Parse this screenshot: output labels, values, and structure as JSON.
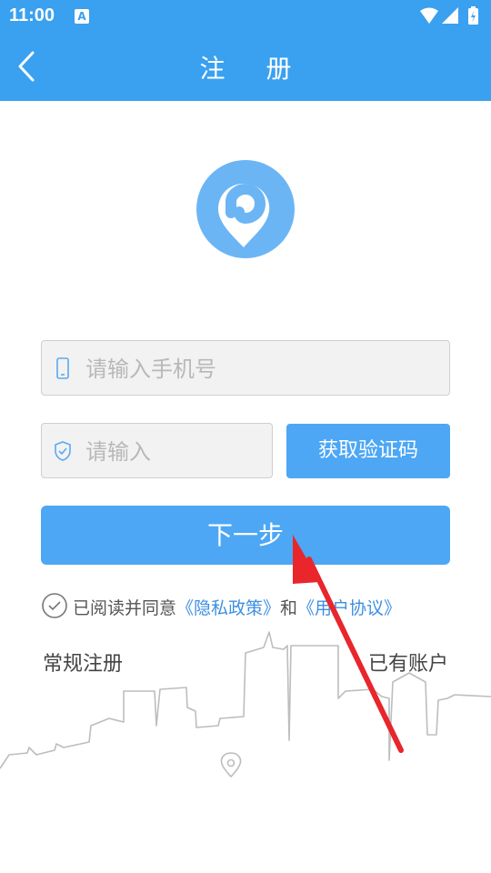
{
  "status_bar": {
    "time": "11:00",
    "notification_icon": "a-notification-icon",
    "icons": [
      "wifi-icon",
      "signal-icon",
      "battery-icon"
    ]
  },
  "header": {
    "title": "注 册",
    "back_icon": "back-arrow-icon"
  },
  "logo_icon": "location-pin-logo",
  "form": {
    "phone": {
      "placeholder": "请输入手机号",
      "value": "",
      "icon": "phone-icon"
    },
    "code": {
      "placeholder": "请输入",
      "value": "",
      "icon": "shield-icon"
    },
    "get_code_label": "获取验证码",
    "next_label": "下一步"
  },
  "agreement": {
    "prefix": "已阅读并同意",
    "privacy_link": "《隐私政策》",
    "and": "和",
    "user_link": "《用户协议》"
  },
  "bottom_links": {
    "normal_register": "常规注册",
    "have_account": "已有账户"
  },
  "colors": {
    "primary": "#3aa0f0",
    "button": "#4da7f4",
    "link": "#3d8fe0",
    "annotation_arrow": "#e8262b"
  }
}
